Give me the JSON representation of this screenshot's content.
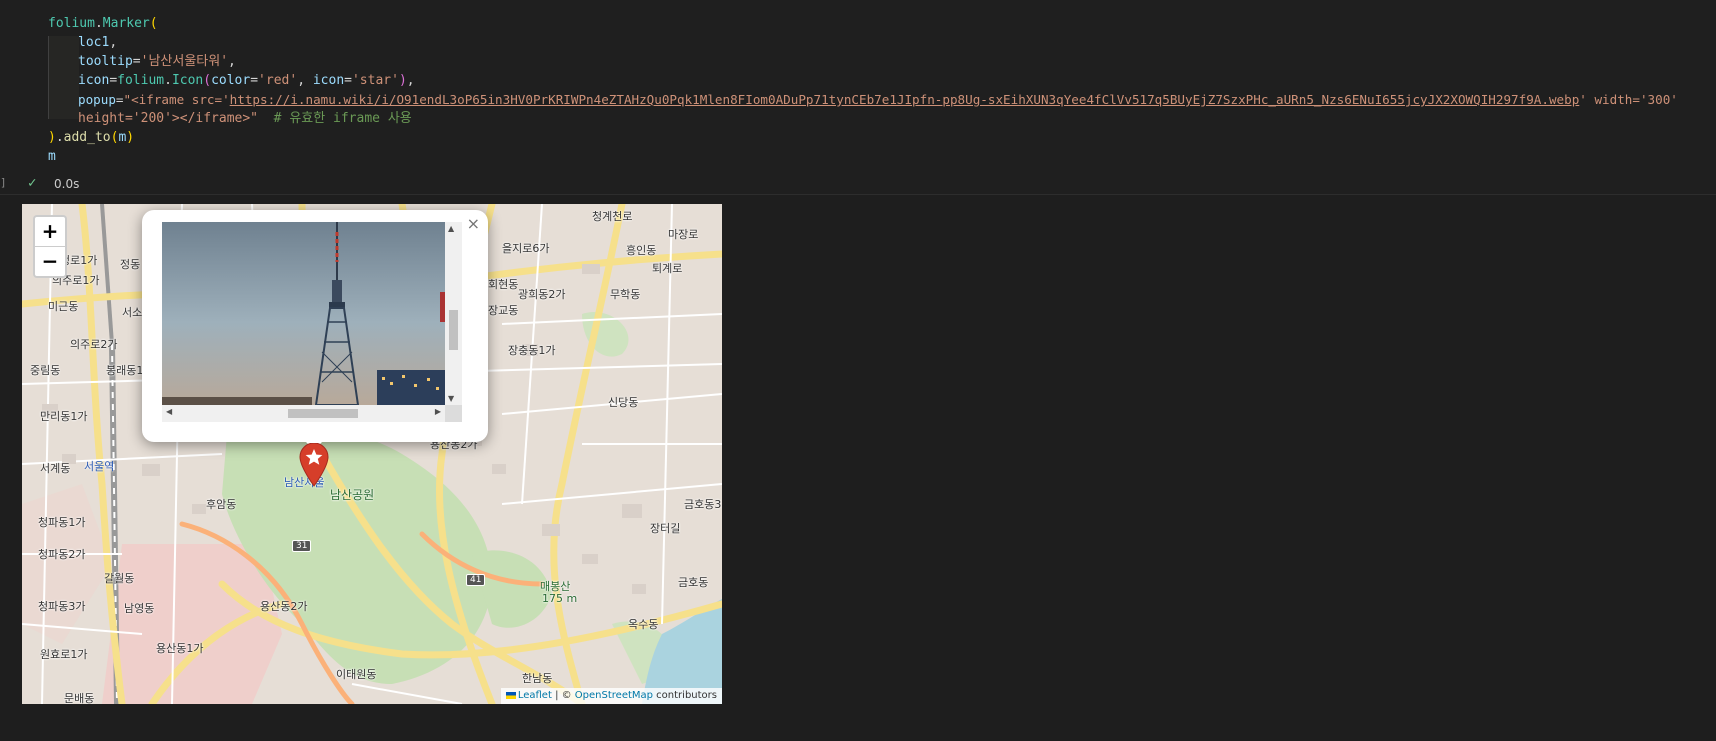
{
  "code": {
    "line1": {
      "fn": "folium",
      "dot": ".",
      "meth": "Marker",
      "paren": "("
    },
    "line2": {
      "var": "loc1",
      "comma": ","
    },
    "line3": {
      "kw": "tooltip",
      "eq": "=",
      "str": "'남산서울타워'",
      "comma": ","
    },
    "line4": {
      "kw": "icon",
      "eq": "=",
      "fn": "folium",
      "dot": ".",
      "meth": "Icon",
      "open": "(",
      "kw2": "color",
      "eq2": "=",
      "str1": "'red'",
      "sep": ", ",
      "kw3": "icon",
      "eq3": "=",
      "str2": "'star'",
      "close": ")",
      "comma": ","
    },
    "line5": {
      "kw": "popup",
      "eq": "=",
      "str_start": "\"<iframe src='",
      "url": "https://i.namu.wiki/i/O91endL3oP65in3HV0PrKRIWPn4eZTAHzQu0Pqk1Mlen8FIom0ADuPp71tynCEb7e1JIpfn-pp8Ug-sxEihXUN3qYee4fClVv517q5BUyEjZ7SzxPHc_aURn5_Nzs6ENuI655jcyJX2XOWQIH297f9A.webp",
      "str_end": "' width='300'"
    },
    "line6": {
      "str": "height='200'></iframe>\"",
      "comment": "# 유효한 iframe 사용"
    },
    "line7": {
      "close": ")",
      "dot": ".",
      "meth": "add_to",
      "open": "(",
      "var": "m",
      "close2": ")"
    },
    "line8": {
      "var": "m"
    }
  },
  "cell_status": {
    "bracket": "]",
    "check_icon": "check-icon",
    "time": "0.0s"
  },
  "map": {
    "zoom_in": "+",
    "zoom_out": "−",
    "popup_close": "×",
    "marker_icon": "star",
    "marker_color": "#d63e2a",
    "attribution": {
      "leaflet": "Leaflet",
      "sep": " | © ",
      "osm": "OpenStreetMap",
      "contrib": " contributors"
    },
    "labels": [
      "청로1가",
      "정동",
      "의주로1가",
      "미근동",
      "서소",
      "의주로2가",
      "중림동",
      "봉래동1",
      "만리동1가",
      "서계동",
      "서울역",
      "청파동1가",
      "청파동2가",
      "청파동3가",
      "갈월동",
      "남영동",
      "원효로1가",
      "문배동",
      "후암동",
      "용산동2가",
      "용산동1가",
      "이태원동",
      "한남동",
      "옥수동",
      "금호동",
      "장충동1가",
      "신당동",
      "광희동2가",
      "을지로6가",
      "흥인동",
      "무학동",
      "장교동",
      "남산공원",
      "매봉산",
      "175 m",
      "남산서울",
      "용산동2가",
      "회현동",
      "청계천로",
      "마장로",
      "퇴계로",
      "장터길",
      "금호동3"
    ],
    "shields": [
      "31",
      "41"
    ]
  }
}
